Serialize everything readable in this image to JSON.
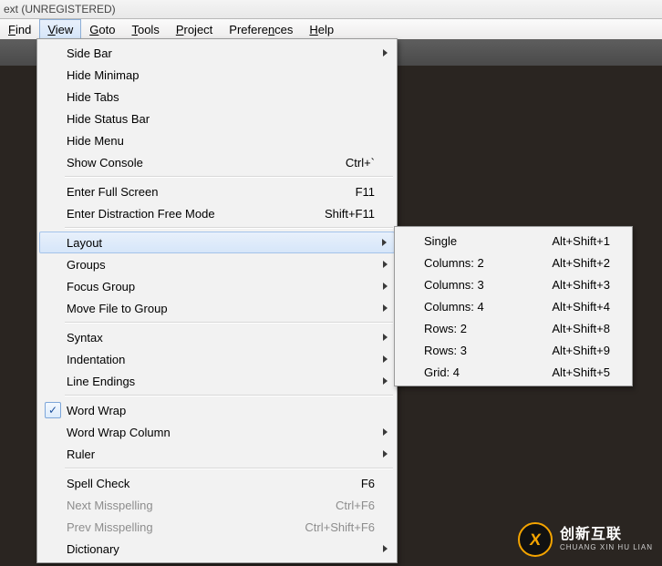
{
  "title": "ext (UNREGISTERED)",
  "menubar": {
    "find": "Find",
    "view": "View",
    "goto": "Goto",
    "tools": "Tools",
    "project": "Project",
    "preferences": "Preferences",
    "help": "Help"
  },
  "viewMenu": {
    "sideBar": "Side Bar",
    "hideMinimap": "Hide Minimap",
    "hideTabs": "Hide Tabs",
    "hideStatusBar": "Hide Status Bar",
    "hideMenu": "Hide Menu",
    "showConsole": "Show Console",
    "showConsole_k": "Ctrl+`",
    "enterFullScreen": "Enter Full Screen",
    "enterFullScreen_k": "F11",
    "enterDistractionFree": "Enter Distraction Free Mode",
    "enterDistractionFree_k": "Shift+F11",
    "layout": "Layout",
    "groups": "Groups",
    "focusGroup": "Focus Group",
    "moveFileToGroup": "Move File to Group",
    "syntax": "Syntax",
    "indentation": "Indentation",
    "lineEndings": "Line Endings",
    "wordWrap": "Word Wrap",
    "wordWrapColumn": "Word Wrap Column",
    "ruler": "Ruler",
    "spellCheck": "Spell Check",
    "spellCheck_k": "F6",
    "nextMisspelling": "Next Misspelling",
    "nextMisspelling_k": "Ctrl+F6",
    "prevMisspelling": "Prev Misspelling",
    "prevMisspelling_k": "Ctrl+Shift+F6",
    "dictionary": "Dictionary"
  },
  "layoutMenu": {
    "single": "Single",
    "single_k": "Alt+Shift+1",
    "cols2": "Columns: 2",
    "cols2_k": "Alt+Shift+2",
    "cols3": "Columns: 3",
    "cols3_k": "Alt+Shift+3",
    "cols4": "Columns: 4",
    "cols4_k": "Alt+Shift+4",
    "rows2": "Rows: 2",
    "rows2_k": "Alt+Shift+8",
    "rows3": "Rows: 3",
    "rows3_k": "Alt+Shift+9",
    "grid4": "Grid: 4",
    "grid4_k": "Alt+Shift+5"
  },
  "logo": {
    "cn": "创新互联",
    "py": "CHUANG XIN HU LIAN"
  }
}
